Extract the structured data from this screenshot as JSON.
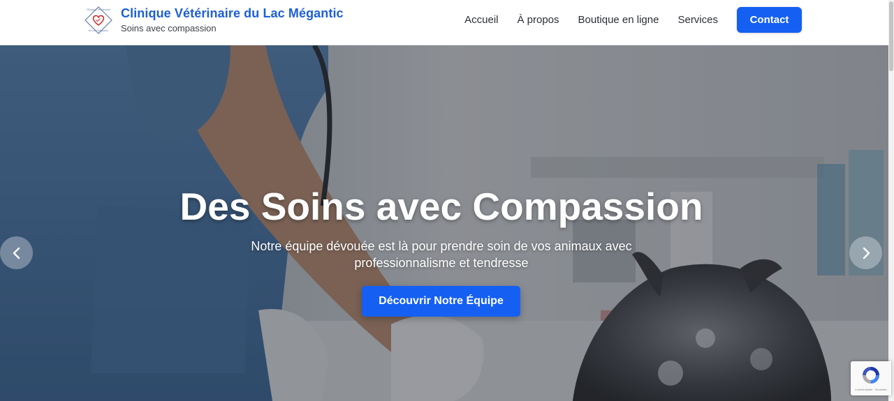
{
  "header": {
    "brand": {
      "title": "Clinique Vétérinaire du Lac Mégantic",
      "tagline": "Soins avec compassion",
      "logo_icon": "clinic-heart-diamond-logo",
      "title_color": "#1d5fd6"
    },
    "nav": {
      "items": [
        {
          "label": "Accueil"
        },
        {
          "label": "À propos"
        },
        {
          "label": "Boutique en ligne"
        },
        {
          "label": "Services"
        }
      ],
      "contact_label": "Contact"
    }
  },
  "hero": {
    "title": "Des Soins avec Compassion",
    "subtitle": "Notre équipe dévouée est là pour prendre soin de vos animaux avec professionnalisme et tendresse",
    "cta_label": "Découvrir Notre Équipe",
    "prev_icon": "chevron-left-icon",
    "next_icon": "chevron-right-icon",
    "background_description_icon": "vet-with-dog-photo"
  },
  "recaptcha": {
    "icon": "recaptcha-icon",
    "text": "Confidentialité - Modalités"
  },
  "colors": {
    "accent": "#1560f2",
    "text_dark": "#2b2f36"
  }
}
